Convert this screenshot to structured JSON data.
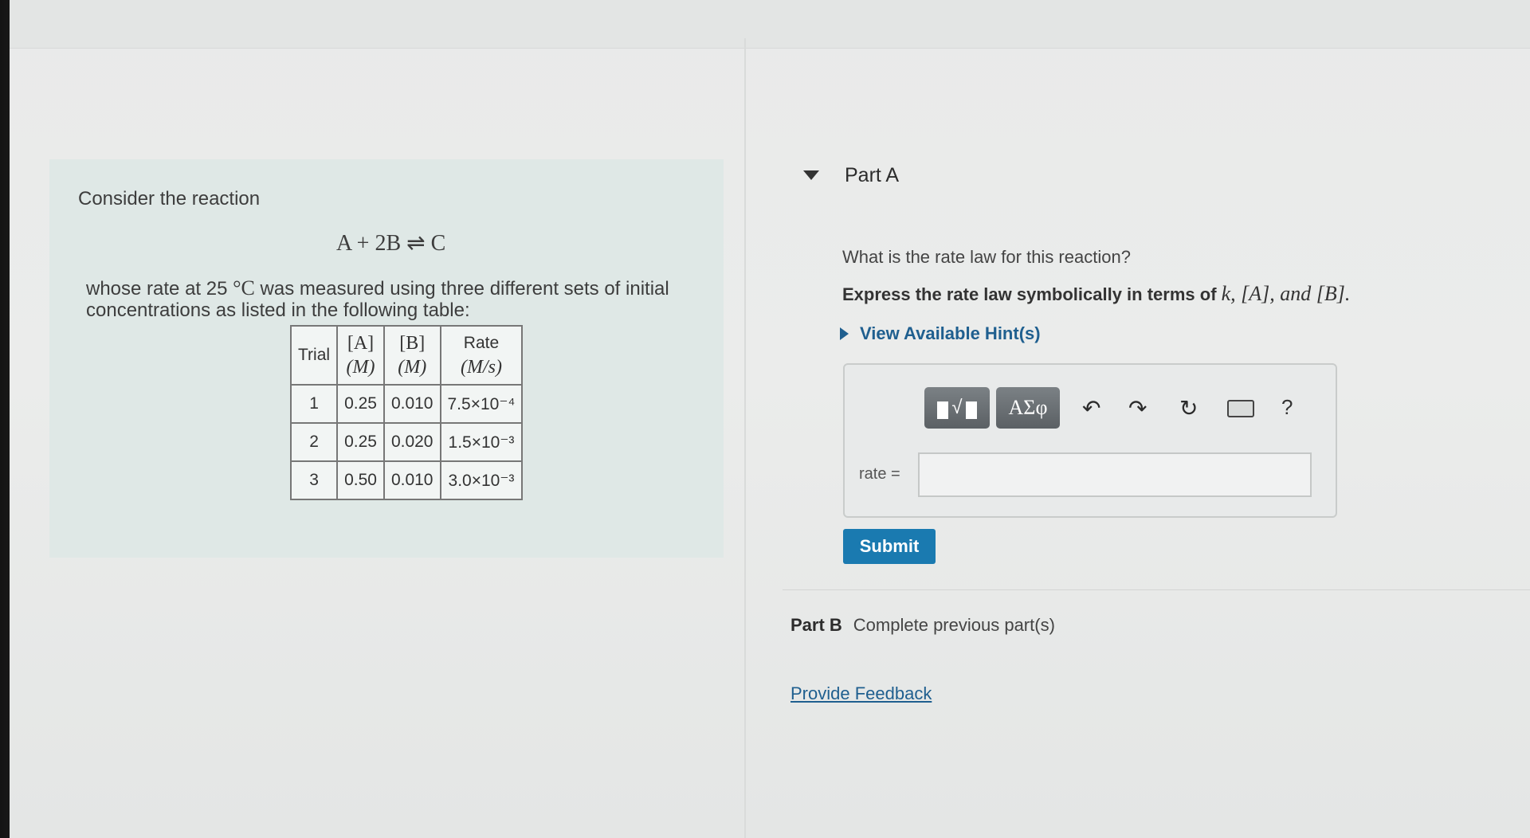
{
  "left_panel": {
    "intro": "Consider the reaction",
    "reaction": "A + 2B ⇌ C",
    "description_before": "whose rate at 25 ",
    "temperature_unit": "°C",
    "description_after": " was measured using three different sets of initial concentrations as listed in the following table:",
    "table": {
      "headers": [
        {
          "top": "Trial",
          "bottom": ""
        },
        {
          "top": "[A]",
          "bottom": "(M)"
        },
        {
          "top": "[B]",
          "bottom": "(M)"
        },
        {
          "top": "Rate",
          "bottom": "(M/s)"
        }
      ],
      "rows": [
        {
          "trial": "1",
          "a": "0.25",
          "b": "0.010",
          "rate": "7.5×10⁻⁴"
        },
        {
          "trial": "2",
          "a": "0.25",
          "b": "0.020",
          "rate": "1.5×10⁻³"
        },
        {
          "trial": "3",
          "a": "0.50",
          "b": "0.010",
          "rate": "3.0×10⁻³"
        }
      ]
    }
  },
  "part_a": {
    "title": "Part A",
    "question": "What is the rate law for this reaction?",
    "instruction_prefix": "Express the rate law symbolically in terms of ",
    "instruction_math": "k, [A], and [B].",
    "hint_label": "View Available Hint(s)",
    "toolbar": {
      "greek_label": "ΑΣφ",
      "undo_icon": "↶",
      "redo_icon": "↷",
      "reset_icon": "↻",
      "help_label": "?"
    },
    "rate_label": "rate =",
    "rate_value": "",
    "submit_label": "Submit"
  },
  "part_b": {
    "title": "Part B",
    "status": "Complete previous part(s)"
  },
  "feedback_link": "Provide Feedback",
  "colors": {
    "accent": "#1a7ab0",
    "link": "#1f5f8f",
    "panel": "#dfe8e6"
  }
}
